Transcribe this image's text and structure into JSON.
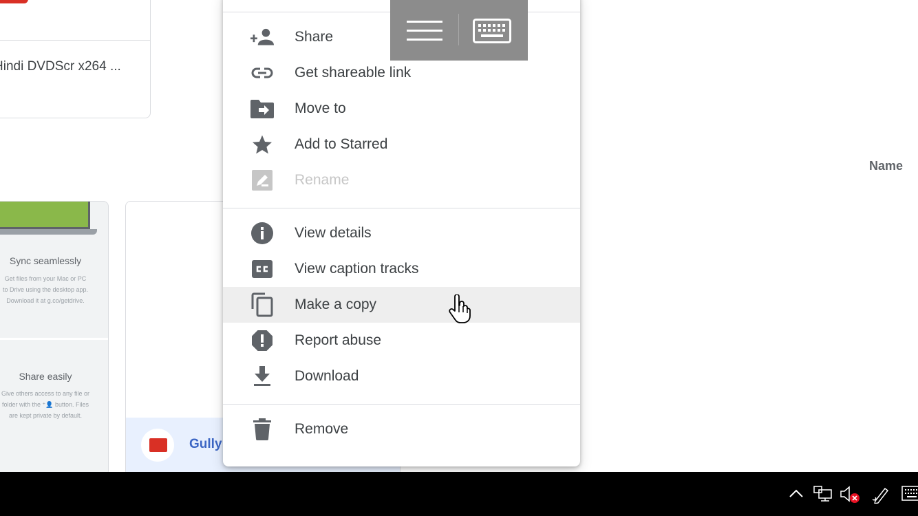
{
  "background": {
    "top_card": {
      "title": "Hindi DVDScr x264 ..."
    },
    "column_header": {
      "name_label": "Name"
    },
    "promo_card": {
      "sync_title": "Sync seamlessly",
      "sync_text": [
        "Get files from your Mac or PC",
        "to Drive using the desktop app.",
        "Download it at g.co/getdrive."
      ],
      "share_title": "Share easily",
      "share_text": [
        "Give others access to any file or",
        "folder with the ⁺👤 button. Files",
        "are kept private by default."
      ]
    },
    "video_card": {
      "name": "Gully"
    }
  },
  "context_menu": {
    "groups": [
      [
        {
          "label": "Share",
          "icon": "person-add-icon",
          "disabled": false,
          "highlighted": false
        },
        {
          "label": "Get shareable link",
          "icon": "link-icon",
          "disabled": false,
          "highlighted": false
        },
        {
          "label": "Move to",
          "icon": "move-to-folder-icon",
          "disabled": false,
          "highlighted": false
        },
        {
          "label": "Add to Starred",
          "icon": "star-icon",
          "disabled": false,
          "highlighted": false
        },
        {
          "label": "Rename",
          "icon": "rename-icon",
          "disabled": true,
          "highlighted": false
        }
      ],
      [
        {
          "label": "View details",
          "icon": "info-icon",
          "disabled": false,
          "highlighted": false
        },
        {
          "label": "View caption tracks",
          "icon": "closed-caption-icon",
          "disabled": false,
          "highlighted": false
        },
        {
          "label": "Make a copy",
          "icon": "copy-icon",
          "disabled": false,
          "highlighted": true
        },
        {
          "label": "Report abuse",
          "icon": "report-icon",
          "disabled": false,
          "highlighted": false
        },
        {
          "label": "Download",
          "icon": "download-icon",
          "disabled": false,
          "highlighted": false
        }
      ],
      [
        {
          "label": "Remove",
          "icon": "trash-icon",
          "disabled": false,
          "highlighted": false
        }
      ]
    ]
  },
  "floating_toolbar": {
    "icons": [
      "hamburger-menu-icon",
      "keyboard-icon"
    ]
  },
  "taskbar": {
    "tray_icons": [
      "chevron-up-icon",
      "network-icon",
      "volume-muted-icon",
      "pen-icon",
      "touch-keyboard-icon"
    ]
  },
  "colors": {
    "menu_icon": "#5f6368",
    "disabled": "#c6c6c6",
    "highlight": "#eeeeee",
    "video_accent": "#d93025",
    "link_blue": "#3c66c4"
  }
}
